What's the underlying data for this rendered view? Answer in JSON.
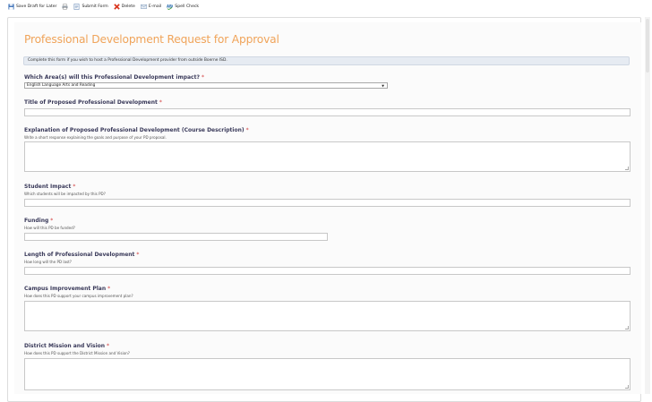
{
  "toolbar": {
    "save_draft": "Save Draft for Later",
    "submit": "Submit Form",
    "delete": "Delete",
    "email": "E-mail",
    "spell_check": "Spell Check"
  },
  "form": {
    "title": "Professional Development Request for Approval",
    "notice": "Complete this form if you wish to host a Professional Development provider from outside Boerne ISD.",
    "required_mark": "*",
    "area": {
      "label": "Which Area(s) will this Professional Development impact?",
      "selected": "English Language Arts and Reading"
    },
    "pd_title": {
      "label": "Title of Proposed Professional Development"
    },
    "explanation": {
      "label": "Explanation of Proposed Professional Development (Course Description)",
      "hint": "Write a short response explaining the goals and purpose of your PD proposal."
    },
    "student_impact": {
      "label": "Student Impact",
      "hint": "Which students will be impacted by this PD?"
    },
    "funding": {
      "label": "Funding",
      "hint": "How will this PD be funded?"
    },
    "length": {
      "label": "Length of Professional Development",
      "hint": "How long will the PD last?"
    },
    "campus_plan": {
      "label": "Campus Improvement Plan",
      "hint": "How does this PD support your campus improvement plan?"
    },
    "mission": {
      "label": "District Mission and Vision",
      "hint": "How does this PD support the District Mission and Vision?"
    }
  },
  "colors": {
    "title": "#f0a45a",
    "required": "#d23c3c",
    "notice_bg": "#e6ebf2",
    "label": "#3a3a5a"
  }
}
